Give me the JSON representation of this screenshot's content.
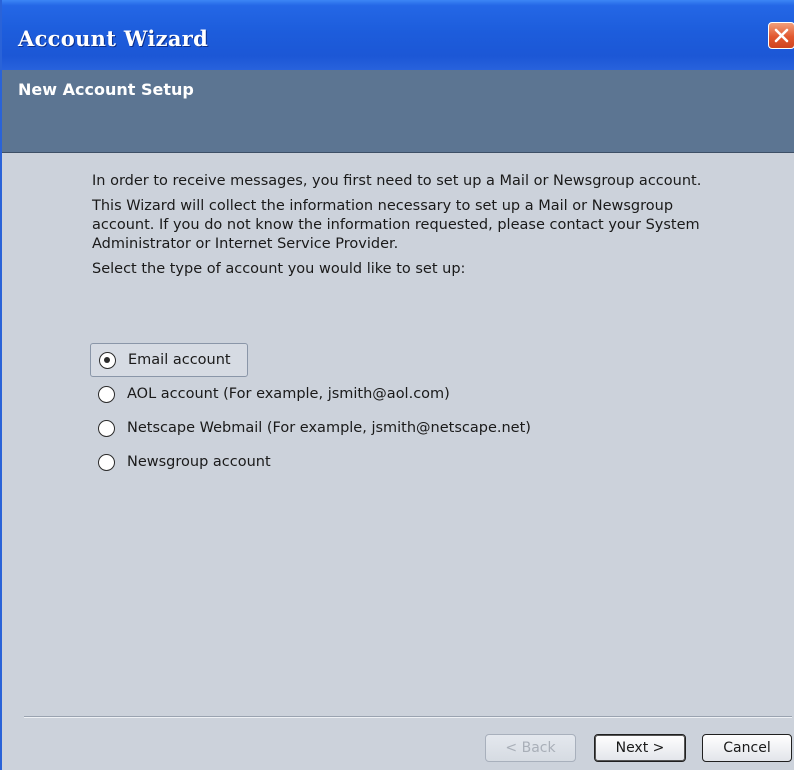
{
  "window": {
    "title": "Account Wizard",
    "close_icon": "close-icon"
  },
  "banner": {
    "title": "New Account Setup"
  },
  "content": {
    "paragraph1": "In order to receive messages, you first need to set up a Mail or Newsgroup account.",
    "paragraph2": "This Wizard will collect the information necessary to set up a Mail or Newsgroup account. If you do not know the information requested, please contact your System Administrator or Internet Service Provider.",
    "prompt": "Select the type of account you would like to set up:"
  },
  "account_types": {
    "selected": "Email account",
    "options": [
      {
        "label": "Email account"
      },
      {
        "label": "AOL account (For example, jsmith@aol.com)"
      },
      {
        "label": "Netscape Webmail (For example, jsmith@netscape.net)"
      },
      {
        "label": "Newsgroup account"
      }
    ]
  },
  "buttons": {
    "back": "< Back",
    "next": "Next >",
    "cancel": "Cancel"
  },
  "colors": {
    "titlebar": "#1d5ddc",
    "banner": "#5c7592",
    "body": "#ccd2db",
    "close": "#e2582f"
  }
}
